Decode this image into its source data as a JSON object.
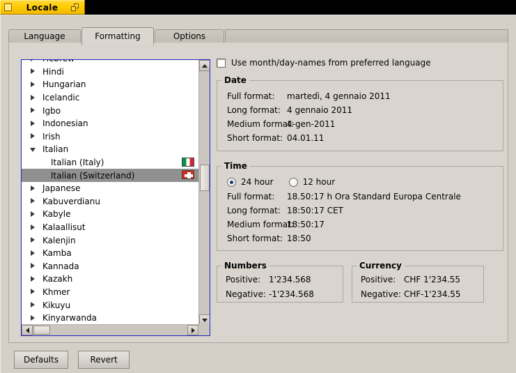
{
  "window": {
    "title": "Locale",
    "icon": "window-square-icon",
    "restore_icon": "restore-window-icon"
  },
  "tabs": [
    {
      "label": "Language",
      "active": false
    },
    {
      "label": "Formatting",
      "active": true
    },
    {
      "label": "Options",
      "active": false
    }
  ],
  "language_list": {
    "items": [
      {
        "label": "Hebrew",
        "expandable": true,
        "expanded": false,
        "child": false,
        "selected": false,
        "clipped": true,
        "flag": null
      },
      {
        "label": "Hindi",
        "expandable": true,
        "expanded": false,
        "child": false,
        "selected": false,
        "flag": null
      },
      {
        "label": "Hungarian",
        "expandable": true,
        "expanded": false,
        "child": false,
        "selected": false,
        "flag": null
      },
      {
        "label": "Icelandic",
        "expandable": true,
        "expanded": false,
        "child": false,
        "selected": false,
        "flag": null
      },
      {
        "label": "Igbo",
        "expandable": true,
        "expanded": false,
        "child": false,
        "selected": false,
        "flag": null
      },
      {
        "label": "Indonesian",
        "expandable": true,
        "expanded": false,
        "child": false,
        "selected": false,
        "flag": null
      },
      {
        "label": "Irish",
        "expandable": true,
        "expanded": false,
        "child": false,
        "selected": false,
        "flag": null
      },
      {
        "label": "Italian",
        "expandable": true,
        "expanded": true,
        "child": false,
        "selected": false,
        "flag": null
      },
      {
        "label": "Italian (Italy)",
        "expandable": false,
        "expanded": false,
        "child": true,
        "selected": false,
        "flag": "flag-italy-icon"
      },
      {
        "label": "Italian (Switzerland)",
        "expandable": false,
        "expanded": false,
        "child": true,
        "selected": true,
        "flag": "flag-switzerland-icon"
      },
      {
        "label": "Japanese",
        "expandable": true,
        "expanded": false,
        "child": false,
        "selected": false,
        "flag": null
      },
      {
        "label": "Kabuverdianu",
        "expandable": true,
        "expanded": false,
        "child": false,
        "selected": false,
        "flag": null
      },
      {
        "label": "Kabyle",
        "expandable": true,
        "expanded": false,
        "child": false,
        "selected": false,
        "flag": null
      },
      {
        "label": "Kalaallisut",
        "expandable": true,
        "expanded": false,
        "child": false,
        "selected": false,
        "flag": null
      },
      {
        "label": "Kalenjin",
        "expandable": true,
        "expanded": false,
        "child": false,
        "selected": false,
        "flag": null
      },
      {
        "label": "Kamba",
        "expandable": true,
        "expanded": false,
        "child": false,
        "selected": false,
        "flag": null
      },
      {
        "label": "Kannada",
        "expandable": true,
        "expanded": false,
        "child": false,
        "selected": false,
        "flag": null
      },
      {
        "label": "Kazakh",
        "expandable": true,
        "expanded": false,
        "child": false,
        "selected": false,
        "flag": null
      },
      {
        "label": "Khmer",
        "expandable": true,
        "expanded": false,
        "child": false,
        "selected": false,
        "flag": null
      },
      {
        "label": "Kikuyu",
        "expandable": true,
        "expanded": false,
        "child": false,
        "selected": false,
        "flag": null
      },
      {
        "label": "Kinyarwanda",
        "expandable": true,
        "expanded": false,
        "child": false,
        "selected": false,
        "clipped": true,
        "flag": null
      }
    ],
    "selected_label": "Italian (Switzerland)",
    "vscroll": {
      "up_icon": "scroll-up-arrow-icon",
      "down_icon": "scroll-down-arrow-icon"
    },
    "hscroll": {
      "left_icon": "scroll-left-arrow-icon",
      "right_icon": "scroll-right-arrow-icon"
    }
  },
  "options": {
    "use_preferred_language_names": {
      "label": "Use month/day-names from preferred language",
      "checked": false
    }
  },
  "date": {
    "legend": "Date",
    "rows": [
      {
        "key": "Full format:",
        "value": "martedì, 4 gennaio 2011"
      },
      {
        "key": "Long format:",
        "value": "4 gennaio 2011"
      },
      {
        "key": "Medium format:",
        "value": "4-gen-2011"
      },
      {
        "key": "Short format:",
        "value": "04.01.11"
      }
    ]
  },
  "time": {
    "legend": "Time",
    "clock": {
      "selected": "24 hour",
      "options": [
        "24 hour",
        "12 hour"
      ]
    },
    "rows": [
      {
        "key": "Full format:",
        "value": "18.50:17 h Ora Standard Europa Centrale"
      },
      {
        "key": "Long format:",
        "value": "18:50:17 CET"
      },
      {
        "key": "Medium format:",
        "value": "18:50:17"
      },
      {
        "key": "Short format:",
        "value": "18:50"
      }
    ]
  },
  "numbers": {
    "legend": "Numbers",
    "rows": [
      {
        "key": "Positive:",
        "value": "1'234.568"
      },
      {
        "key": "Negative:",
        "value": "-1'234.568"
      }
    ]
  },
  "currency": {
    "legend": "Currency",
    "rows": [
      {
        "key": "Positive:",
        "value": "CHF 1'234.55"
      },
      {
        "key": "Negative:",
        "value": "CHF-1'234.55"
      }
    ]
  },
  "buttons": {
    "defaults": "Defaults",
    "revert": "Revert"
  },
  "colors": {
    "titlebar": "#ffcc00",
    "window_bg": "#d4d0c8",
    "selection": "#909090",
    "list_border": "#2222bb",
    "radio_dot": "#12386e"
  }
}
